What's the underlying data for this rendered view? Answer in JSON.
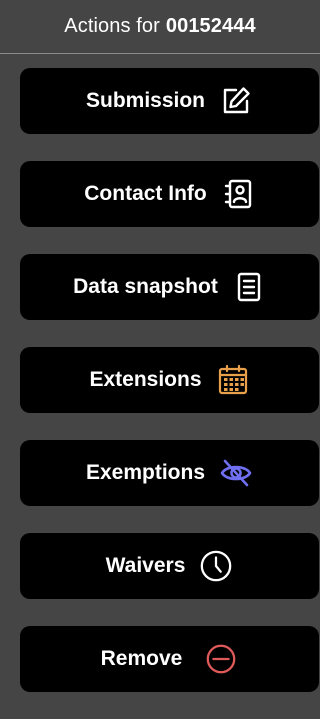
{
  "header": {
    "prefix": "Actions for",
    "id": "00152444"
  },
  "actions": [
    {
      "label": "Submission",
      "icon": "edit-icon",
      "color": "#ffffff"
    },
    {
      "label": "Contact Info",
      "icon": "contact-card-icon",
      "color": "#ffffff"
    },
    {
      "label": "Data snapshot",
      "icon": "document-lines-icon",
      "color": "#ffffff"
    },
    {
      "label": "Extensions",
      "icon": "calendar-icon",
      "color": "#e8a04a"
    },
    {
      "label": "Exemptions",
      "icon": "eye-off-icon",
      "color": "#6f6ff0"
    },
    {
      "label": "Waivers",
      "icon": "clock-icon",
      "color": "#ffffff"
    },
    {
      "label": "Remove",
      "icon": "minus-circle-icon",
      "color": "#e05a5a"
    }
  ]
}
